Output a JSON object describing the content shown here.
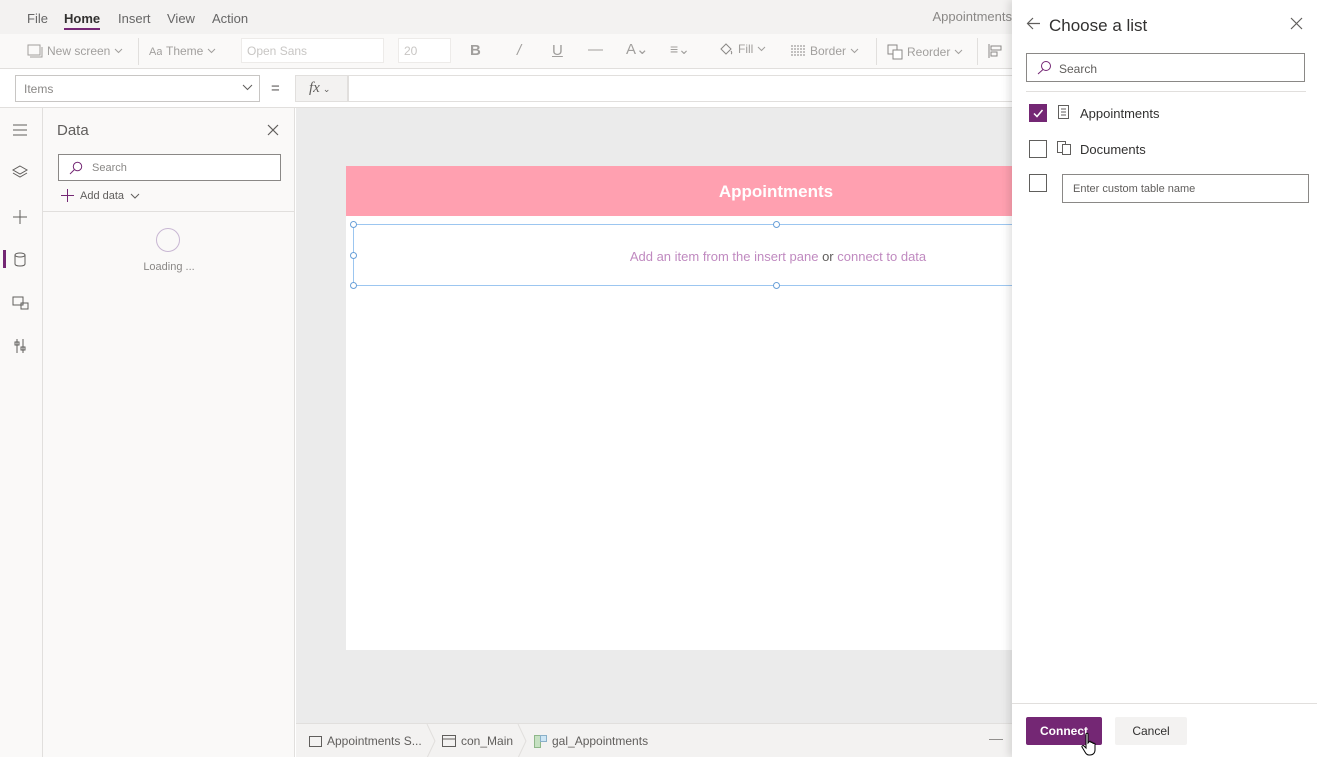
{
  "menu": {
    "items": [
      {
        "label": "File"
      },
      {
        "label": "Home",
        "active": true
      },
      {
        "label": "Insert"
      },
      {
        "label": "View"
      },
      {
        "label": "Action"
      }
    ],
    "app_title": "Appointments"
  },
  "ribbon": {
    "new_screen": "New screen",
    "theme": "Theme",
    "font": "Open Sans",
    "font_size": "20",
    "fill": "Fill",
    "border": "Border",
    "reorder": "Reorder"
  },
  "formula_bar": {
    "property": "Items",
    "equals": "=",
    "fx_label": "fx",
    "formula": ""
  },
  "rail": {
    "icons": [
      "hamburger-icon",
      "layers-icon",
      "plus-icon",
      "database-icon",
      "media-icon",
      "tools-icon"
    ],
    "active": "database-icon"
  },
  "data_pane": {
    "title": "Data",
    "search_placeholder": "Search",
    "add_data": "Add data",
    "loading": "Loading ..."
  },
  "canvas": {
    "header_title": "Appointments",
    "header_color": "#ffa0b0",
    "gallery_message": {
      "part1": "Add an item from the insert pane",
      "part2": "or",
      "part3": "connect to data"
    }
  },
  "breadcrumb": {
    "items": [
      {
        "label": "Appointments S...",
        "icon": "screen-icon"
      },
      {
        "label": "con_Main",
        "icon": "container-icon"
      },
      {
        "label": "gal_Appointments",
        "icon": "gallery-icon"
      }
    ],
    "zoom_minus": "—"
  },
  "panel": {
    "title": "Choose a list",
    "search_placeholder": "Search",
    "lists": [
      {
        "label": "Appointments",
        "checked": true,
        "icon": "list-icon"
      },
      {
        "label": "Documents",
        "checked": false,
        "icon": "library-icon"
      }
    ],
    "custom_placeholder": "Enter custom table name",
    "connect_label": "Connect",
    "cancel_label": "Cancel",
    "accent_color": "#742774"
  }
}
